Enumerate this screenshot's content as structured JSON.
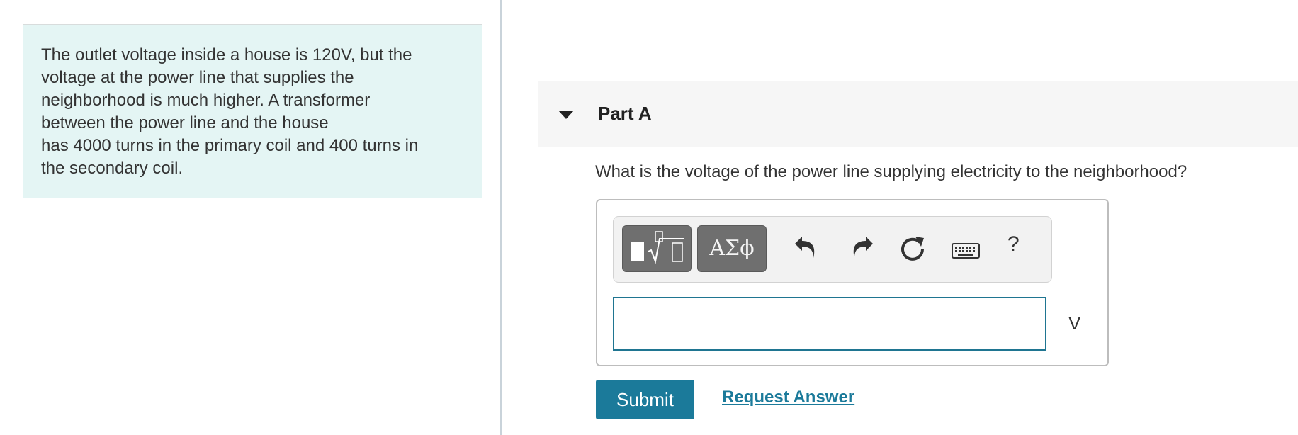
{
  "problem": {
    "text": "The outlet voltage inside a house is 120V, but the\nvoltage at the power line that supplies the\nneighborhood is much higher.  A transformer\nbetween the power line and the house\nhas 4000 turns in the primary coil and 400 turns in\nthe secondary coil."
  },
  "part": {
    "title": "Part A",
    "question": "What is the voltage of the power line supplying electricity to the neighborhood?"
  },
  "toolbar": {
    "templates_icon": "sqrt-template-icon",
    "greek_label": "ΑΣϕ",
    "undo_icon": "undo-icon",
    "redo_icon": "redo-icon",
    "reset_icon": "reset-icon",
    "keyboard_icon": "keyboard-icon",
    "help_label": "?"
  },
  "answer": {
    "value": "",
    "unit": "V"
  },
  "actions": {
    "submit_label": "Submit",
    "request_label": "Request Answer"
  },
  "colors": {
    "problem_bg": "#e4f5f4",
    "accent": "#1b7a9a",
    "toolbar_button": "#6f6f6f"
  }
}
